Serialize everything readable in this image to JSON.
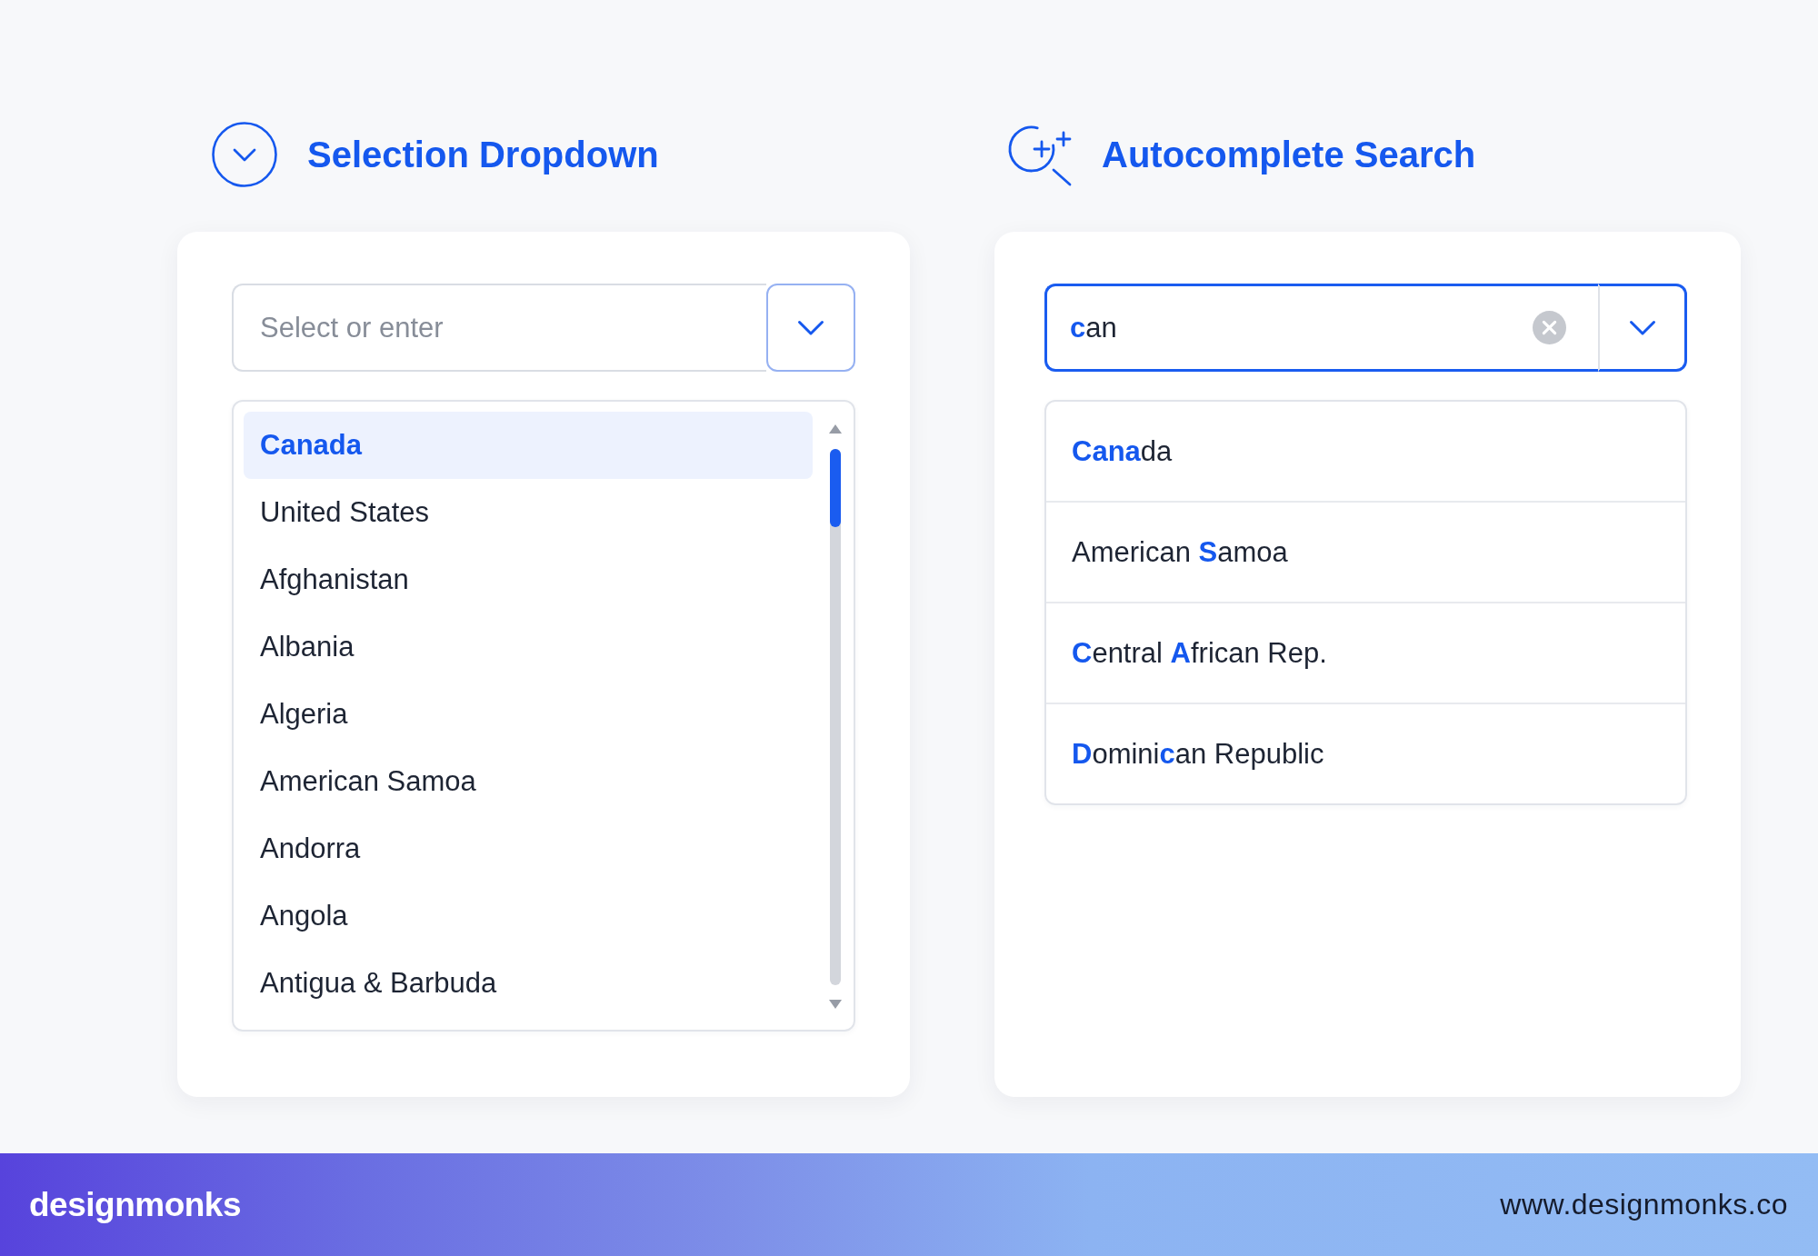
{
  "sections": [
    {
      "kind": "dropdown",
      "title": "Selection Dropdown",
      "field": {
        "placeholder": "Select or enter",
        "focused": false
      },
      "options": [
        {
          "label": "Canada",
          "selected": true
        },
        {
          "label": "United States",
          "selected": false
        },
        {
          "label": "Afghanistan",
          "selected": false
        },
        {
          "label": "Albania",
          "selected": false
        },
        {
          "label": "Algeria",
          "selected": false
        },
        {
          "label": "American Samoa",
          "selected": false
        },
        {
          "label": "Andorra",
          "selected": false
        },
        {
          "label": "Angola",
          "selected": false
        },
        {
          "label": "Antigua & Barbuda",
          "selected": false
        }
      ]
    },
    {
      "kind": "autocomplete",
      "title": "Autocomplete Search",
      "field": {
        "value": "**c**an",
        "focused": true
      },
      "suggestions": [
        "**Cana**da",
        "American **S**amoa",
        "**C**entral **A**frican Rep.",
        "**D**omini**c**an Republic"
      ]
    }
  ],
  "footer": {
    "brand": "designmonks",
    "url": "www.designmonks.co"
  }
}
